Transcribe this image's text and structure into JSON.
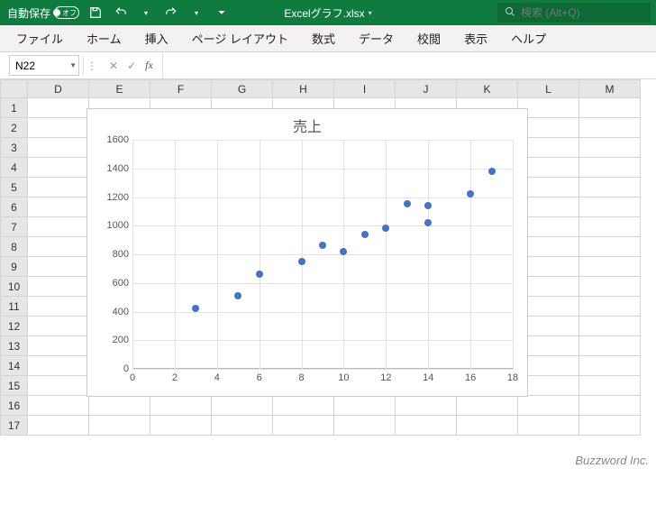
{
  "titlebar": {
    "autosave": "自動保存",
    "autosave_state": "オフ",
    "doc_name": "Excelグラフ.xlsx",
    "search_placeholder": "検索 (Alt+Q)"
  },
  "ribbon": {
    "tabs": [
      "ファイル",
      "ホーム",
      "挿入",
      "ページ レイアウト",
      "数式",
      "データ",
      "校閲",
      "表示",
      "ヘルプ"
    ]
  },
  "formula": {
    "namebox": "N22",
    "fx": "fx"
  },
  "grid": {
    "cols": [
      "D",
      "E",
      "F",
      "G",
      "H",
      "I",
      "J",
      "K",
      "L",
      "M"
    ],
    "rows": [
      "1",
      "2",
      "3",
      "4",
      "5",
      "6",
      "7",
      "8",
      "9",
      "10",
      "11",
      "12",
      "13",
      "14",
      "15",
      "16",
      "17"
    ]
  },
  "chart_data": {
    "type": "scatter",
    "title": "売上",
    "xlabel": "",
    "ylabel": "",
    "xlim": [
      0,
      18
    ],
    "ylim": [
      0,
      1600
    ],
    "xticks": [
      0,
      2,
      4,
      6,
      8,
      10,
      12,
      14,
      16,
      18
    ],
    "yticks": [
      0,
      200,
      400,
      600,
      800,
      1000,
      1200,
      1400,
      1600
    ],
    "series": [
      {
        "name": "売上",
        "points": [
          {
            "x": 3,
            "y": 420
          },
          {
            "x": 5,
            "y": 510
          },
          {
            "x": 6,
            "y": 660
          },
          {
            "x": 8,
            "y": 750
          },
          {
            "x": 9,
            "y": 860
          },
          {
            "x": 10,
            "y": 820
          },
          {
            "x": 11,
            "y": 940
          },
          {
            "x": 12,
            "y": 980
          },
          {
            "x": 13,
            "y": 1150
          },
          {
            "x": 14,
            "y": 1020
          },
          {
            "x": 14,
            "y": 1140
          },
          {
            "x": 16,
            "y": 1220
          },
          {
            "x": 17,
            "y": 1380
          }
        ]
      }
    ]
  },
  "watermark": "Buzzword Inc."
}
